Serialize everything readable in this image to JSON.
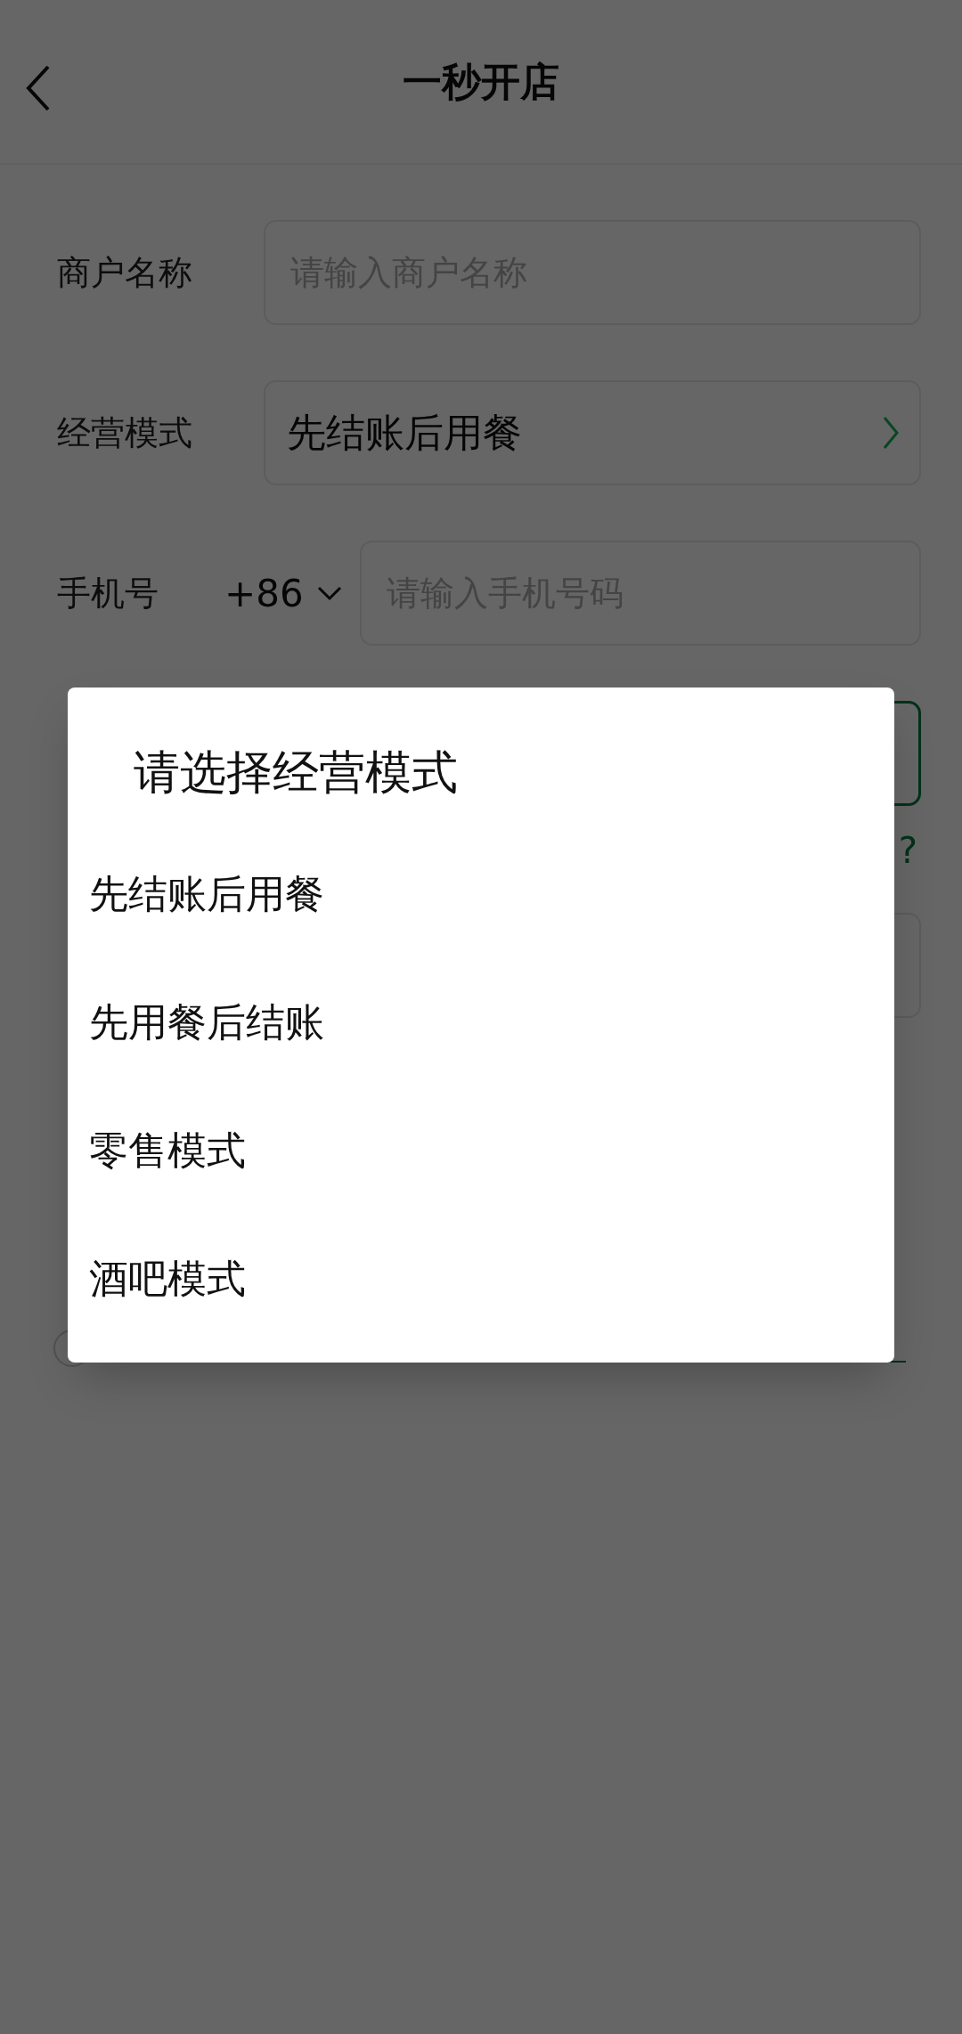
{
  "header": {
    "title": "一秒开店"
  },
  "form": {
    "merchant_name": {
      "label": "商户名称",
      "placeholder": "请输入商户名称"
    },
    "business_mode": {
      "label": "经营模式",
      "value": "先结账后用餐"
    },
    "phone": {
      "label": "手机号",
      "country_code": "+86",
      "placeholder": "请输入手机号码"
    },
    "help_mark": "?",
    "agree": {
      "checked": false
    }
  },
  "dialog": {
    "title": "请选择经营模式",
    "options": [
      {
        "label": "先结账后用餐"
      },
      {
        "label": "先用餐后结账"
      },
      {
        "label": "零售模式"
      },
      {
        "label": "酒吧模式"
      }
    ]
  }
}
